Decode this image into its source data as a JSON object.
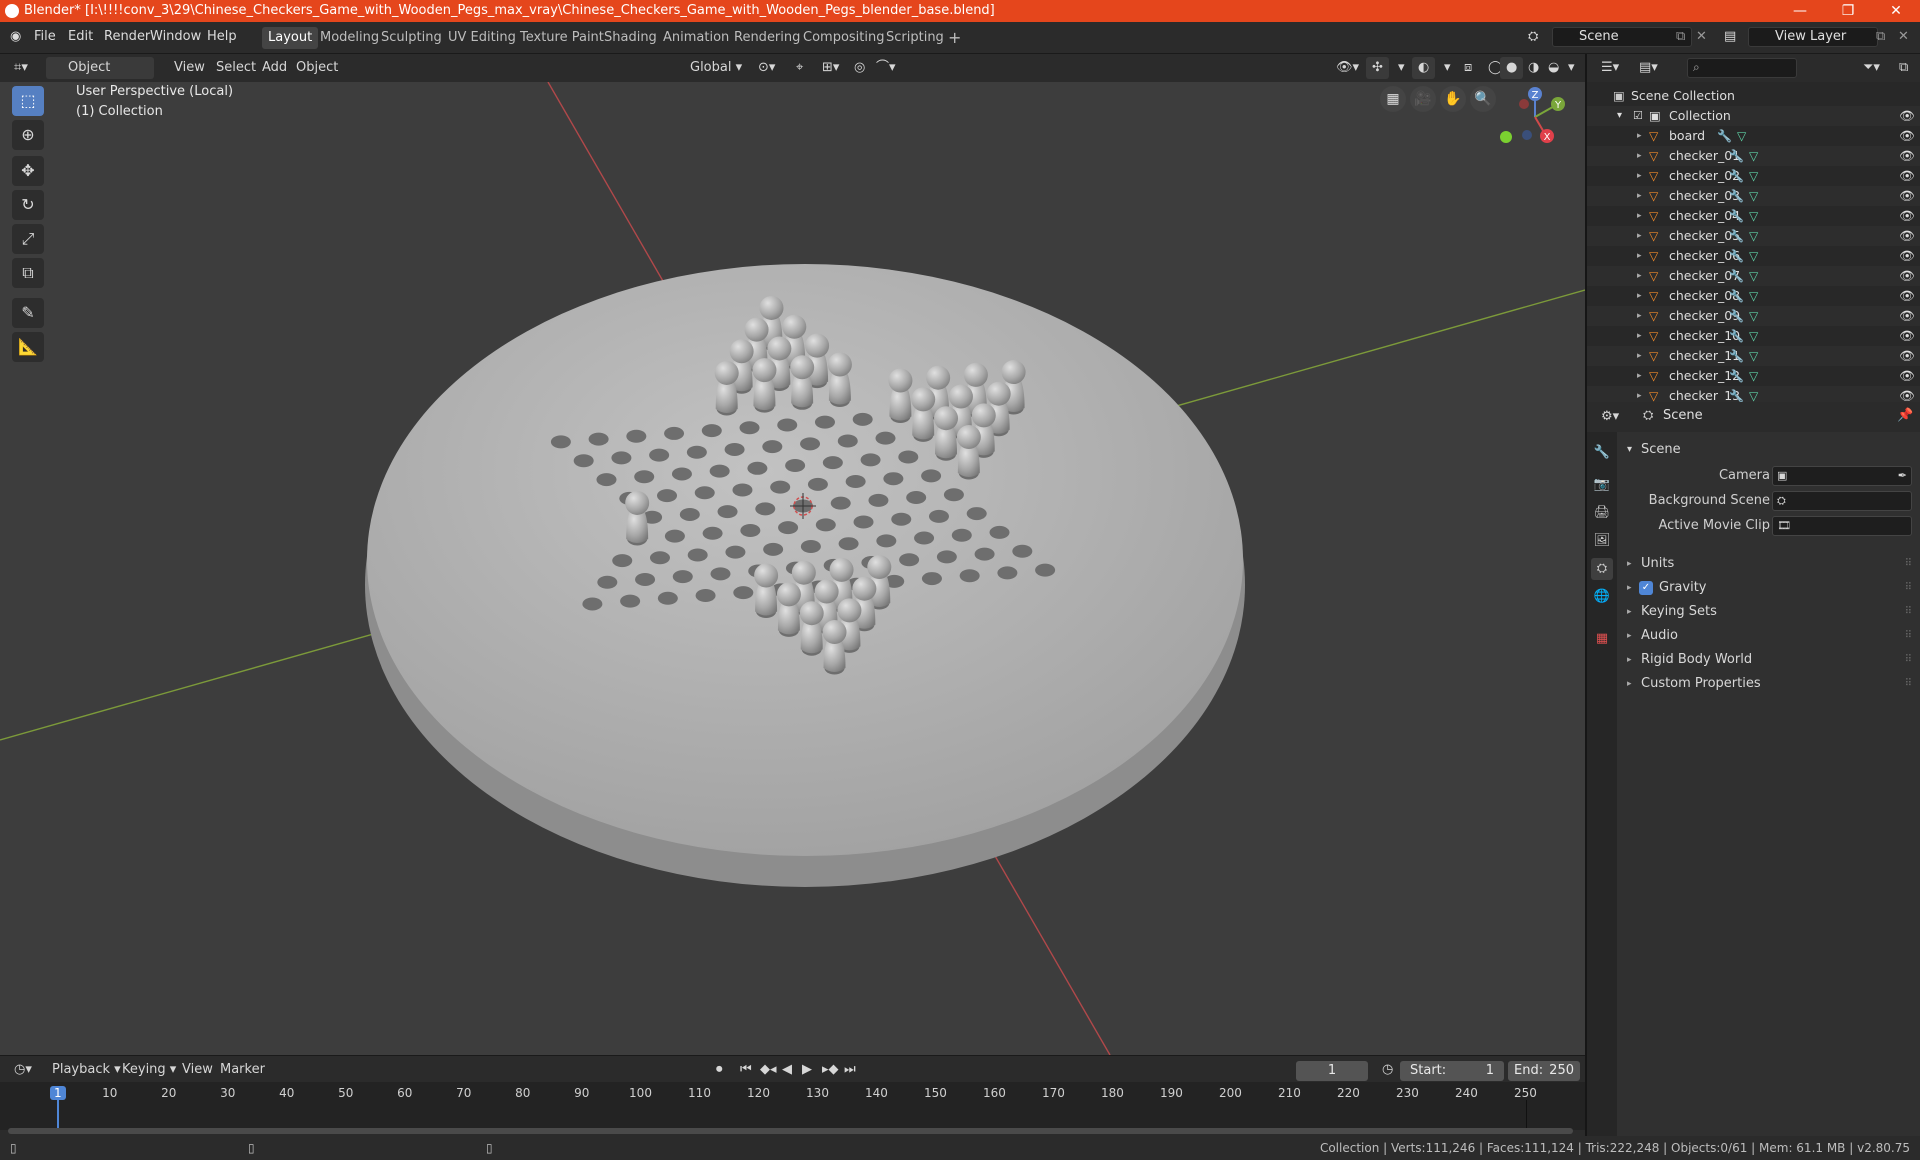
{
  "window": {
    "title": "Blender* [I:\\!!!!conv_3\\29\\Chinese_Checkers_Game_with_Wooden_Pegs_max_vray\\Chinese_Checkers_Game_with_Wooden_Pegs_blender_base.blend]"
  },
  "menu": [
    "File",
    "Edit",
    "Render",
    "Window",
    "Help"
  ],
  "workspaces": [
    {
      "label": "Layout",
      "active": true
    },
    {
      "label": "Modeling"
    },
    {
      "label": "Sculpting"
    },
    {
      "label": "UV Editing"
    },
    {
      "label": "Texture Paint"
    },
    {
      "label": "Shading"
    },
    {
      "label": "Animation"
    },
    {
      "label": "Rendering"
    },
    {
      "label": "Compositing"
    },
    {
      "label": "Scripting"
    }
  ],
  "scene_field": "Scene",
  "viewlayer_field": "View Layer",
  "viewport_header": {
    "mode": "Object Mode",
    "menus": [
      "View",
      "Select",
      "Add",
      "Object"
    ],
    "orientation": "Global"
  },
  "viewport": {
    "perspective": "User Perspective (Local)",
    "collection": "(1) Collection",
    "gizmo": {
      "z": "Z",
      "y": "Y",
      "x": "X"
    }
  },
  "outliner": {
    "root": "Scene Collection",
    "collection": "Collection",
    "items": [
      "board",
      "checker_01",
      "checker_02",
      "checker_03",
      "checker_04",
      "checker_05",
      "checker_06",
      "checker_07",
      "checker_08",
      "checker_09",
      "checker_10",
      "checker_11",
      "checker_12",
      "checker_13"
    ]
  },
  "properties": {
    "context": "Scene",
    "panel": "Scene",
    "fields": [
      {
        "label": "Camera"
      },
      {
        "label": "Background Scene"
      },
      {
        "label": "Active Movie Clip"
      }
    ],
    "sections": [
      "Units",
      "Gravity",
      "Keying Sets",
      "Audio",
      "Rigid Body World",
      "Custom Properties"
    ]
  },
  "timeline": {
    "menus": [
      "Playback",
      "Keying",
      "View",
      "Marker"
    ],
    "current_frame": "1",
    "start_label": "Start:",
    "start": "1",
    "end_label": "End:",
    "end": "250",
    "ticks": [
      "1",
      "10",
      "20",
      "30",
      "40",
      "50",
      "60",
      "70",
      "80",
      "90",
      "100",
      "110",
      "120",
      "130",
      "140",
      "150",
      "160",
      "170",
      "180",
      "190",
      "200",
      "210",
      "220",
      "230",
      "240",
      "250"
    ]
  },
  "status": "Collection | Verts:111,246 | Faces:111,124 | Tris:222,248 | Objects:0/61 | Mem: 61.1 MB | v2.80.75"
}
